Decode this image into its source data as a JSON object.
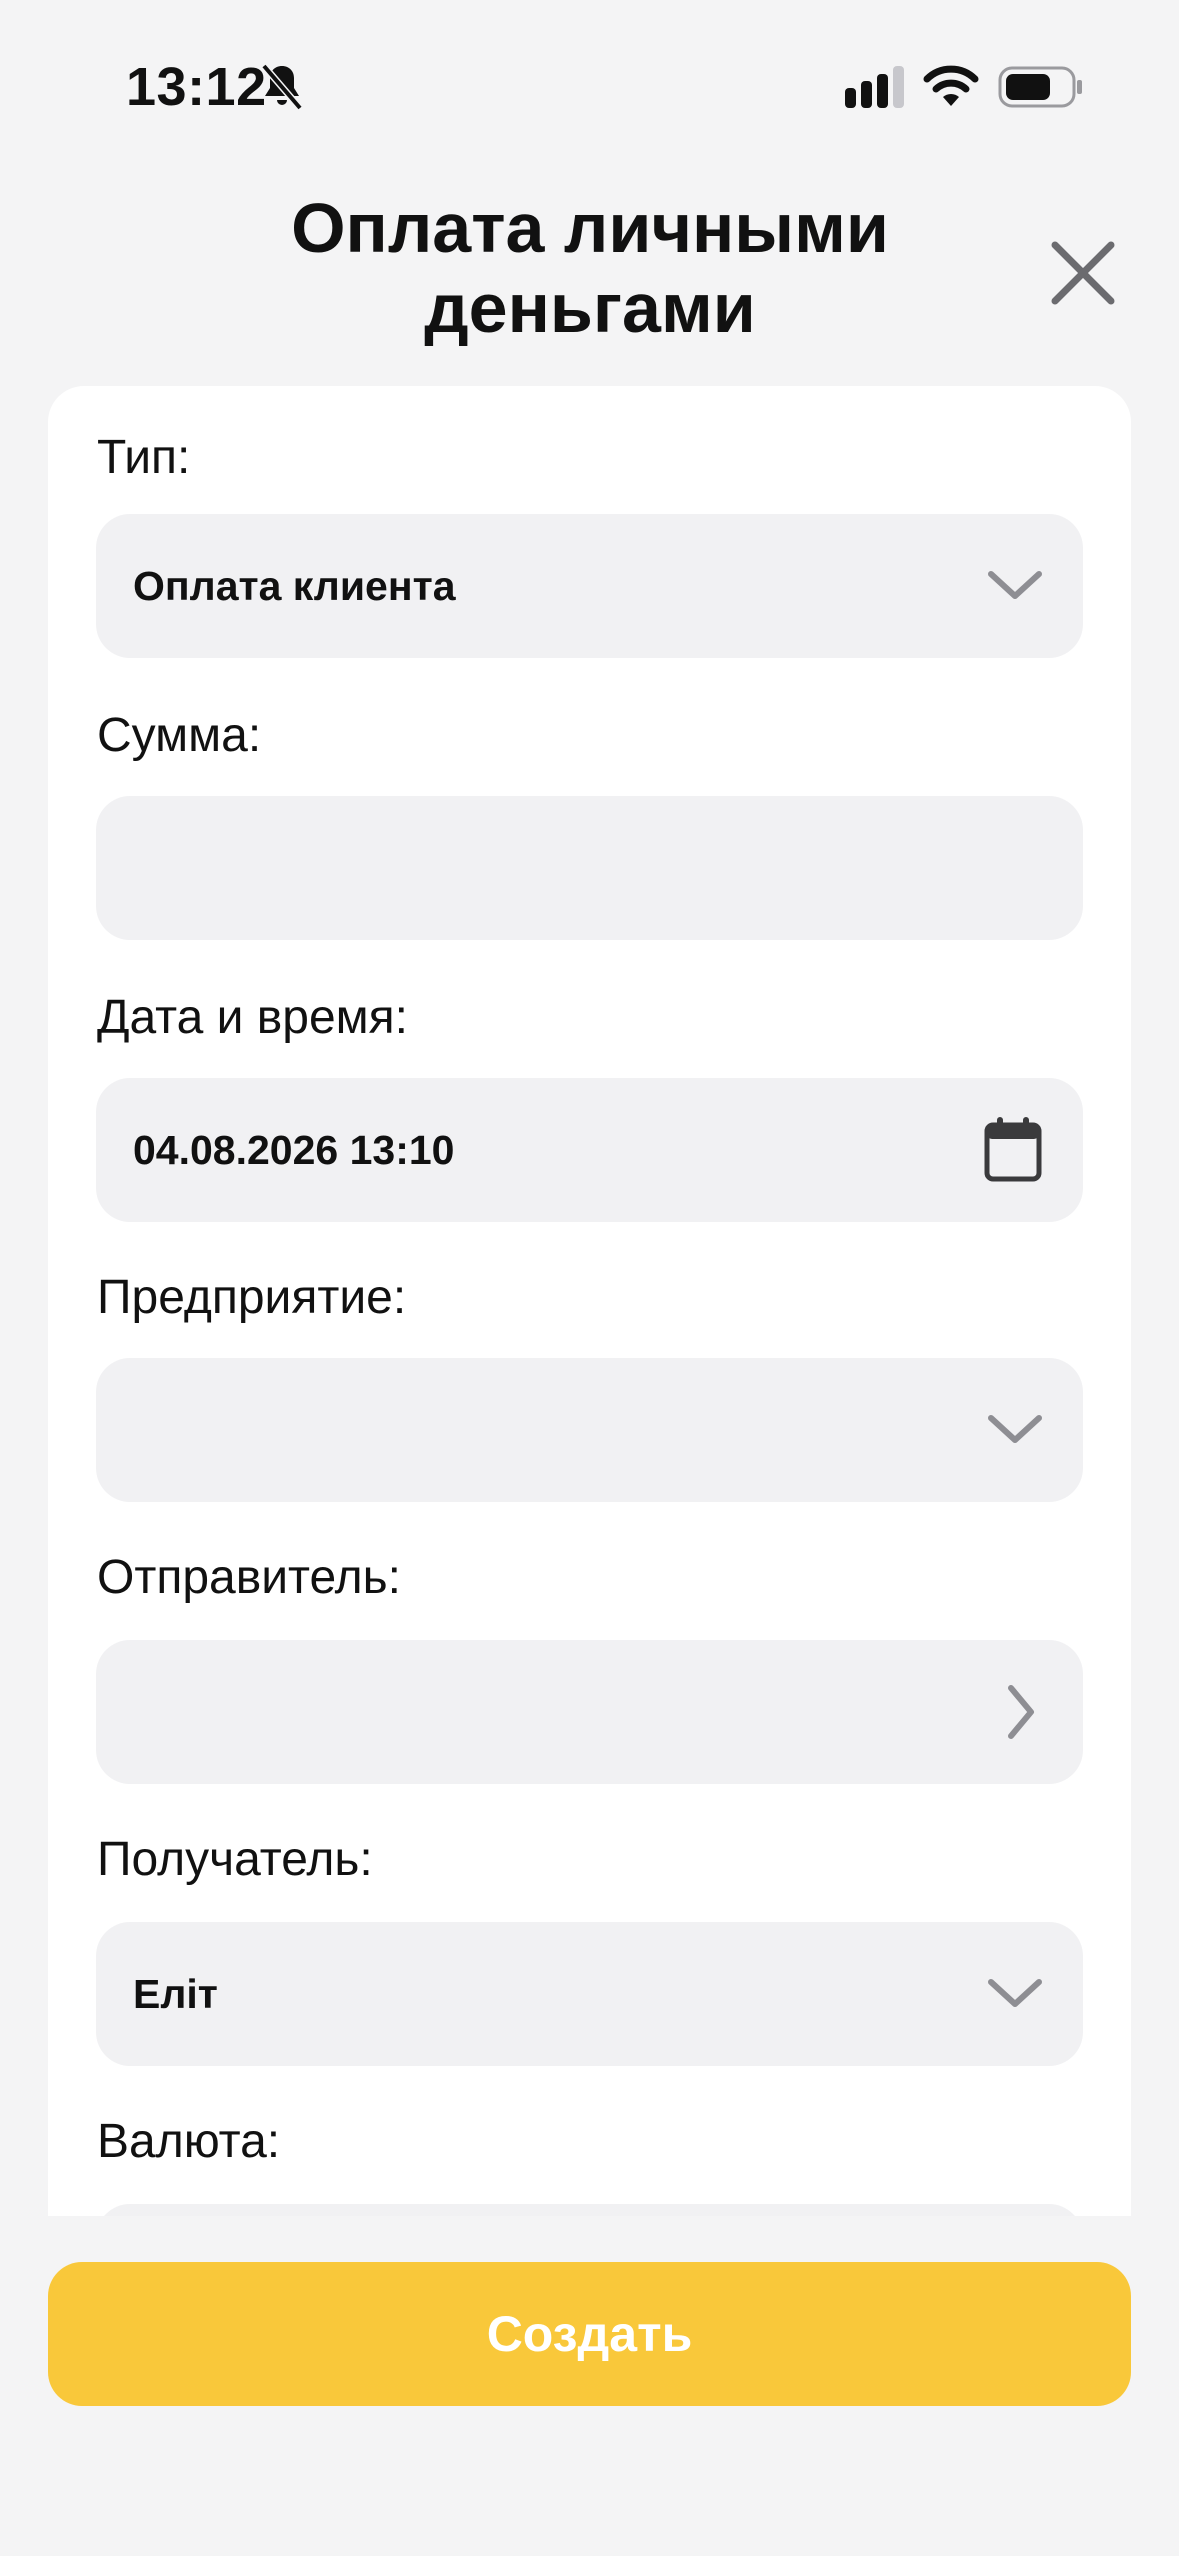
{
  "status_bar": {
    "time": "13:12",
    "icons": [
      "mute-icon",
      "signal-icon",
      "wifi-icon",
      "battery-icon"
    ]
  },
  "header": {
    "title": "Оплата личными деньгами",
    "close_icon": "close-icon"
  },
  "form": {
    "type": {
      "label": "Тип:",
      "value": "Оплата клиента",
      "icon": "chevron-down-icon"
    },
    "amount": {
      "label": "Сумма:",
      "value": ""
    },
    "datetime": {
      "label": "Дата и время:",
      "value": "04.08.2026 13:10",
      "icon": "calendar-icon"
    },
    "enterprise": {
      "label": "Предприятие:",
      "value": "",
      "icon": "chevron-down-icon"
    },
    "sender": {
      "label": "Отправитель:",
      "value": "",
      "icon": "chevron-right-icon"
    },
    "recipient": {
      "label": "Получатель:",
      "value": "Еліт",
      "icon": "chevron-down-icon"
    },
    "currency": {
      "label": "Валюта:",
      "value": ""
    }
  },
  "actions": {
    "create_label": "Создать"
  },
  "colors": {
    "background": "#f4f4f5",
    "card": "#ffffff",
    "field": "#f1f1f3",
    "accent": "#f9c83a",
    "icon_gray": "#8e8e93"
  }
}
